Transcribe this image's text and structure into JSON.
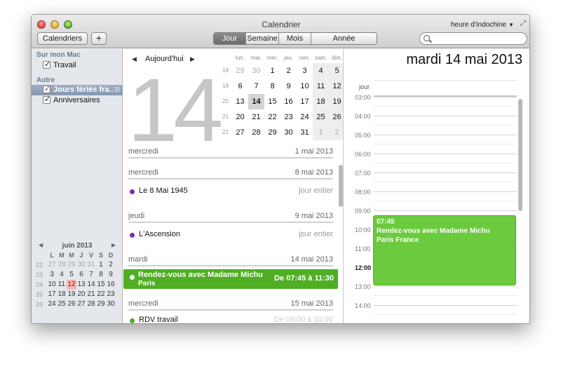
{
  "window": {
    "title": "Calendrier",
    "timezone": "heure d'Indochine"
  },
  "toolbar": {
    "calendars_label": "Calendriers",
    "add_label": "+",
    "views": [
      "Jour",
      "Semaine",
      "Mois",
      "Année"
    ],
    "active_view": "Jour",
    "search_placeholder": ""
  },
  "sidebar": {
    "group_mac": "Sur mon Mac",
    "work": "Travail",
    "group_other": "Autre",
    "holidays": "Jours fériés fra...",
    "birthdays": "Anniversaires"
  },
  "mini_calendar": {
    "month": "juin 2013",
    "dow": [
      "L",
      "M",
      "M",
      "J",
      "V",
      "S",
      "D"
    ],
    "weeks": [
      {
        "wk": "22",
        "days": [
          "27",
          "28",
          "29",
          "30",
          "31",
          "1",
          "2"
        ]
      },
      {
        "wk": "23",
        "days": [
          "3",
          "4",
          "5",
          "6",
          "7",
          "8",
          "9"
        ]
      },
      {
        "wk": "24",
        "days": [
          "10",
          "11",
          "12",
          "13",
          "14",
          "15",
          "16"
        ]
      },
      {
        "wk": "25",
        "days": [
          "17",
          "18",
          "19",
          "20",
          "21",
          "22",
          "23"
        ]
      },
      {
        "wk": "26",
        "days": [
          "24",
          "25",
          "26",
          "27",
          "28",
          "29",
          "30"
        ]
      }
    ]
  },
  "middle": {
    "today_label": "Aujourd'hui",
    "big_day": "14",
    "month_cal": {
      "dow": [
        "lun.",
        "mar.",
        "mer.",
        "jeu.",
        "ven.",
        "sam.",
        "dim."
      ],
      "weeks": [
        {
          "wk": "18",
          "days": [
            "29",
            "30",
            "1",
            "2",
            "3",
            "4",
            "5"
          ]
        },
        {
          "wk": "19",
          "days": [
            "6",
            "7",
            "8",
            "9",
            "10",
            "11",
            "12"
          ]
        },
        {
          "wk": "20",
          "days": [
            "13",
            "14",
            "15",
            "16",
            "17",
            "18",
            "19"
          ]
        },
        {
          "wk": "21",
          "days": [
            "20",
            "21",
            "22",
            "23",
            "24",
            "25",
            "26"
          ]
        },
        {
          "wk": "22",
          "days": [
            "27",
            "28",
            "29",
            "30",
            "31",
            "1",
            "2"
          ]
        }
      ]
    },
    "agenda": {
      "d1": {
        "dow": "mercredi",
        "date": "1 mai 2013"
      },
      "d2": {
        "dow": "mercredi",
        "date": "8 mai 2013"
      },
      "e2": {
        "title": "Le 8 Mai 1945",
        "when": "jour entier"
      },
      "d3": {
        "dow": "jeudi",
        "date": "9 mai 2013"
      },
      "e3": {
        "title": "L'Ascension",
        "when": "jour entier"
      },
      "d4": {
        "dow": "mardi",
        "date": "14 mai 2013"
      },
      "e4": {
        "title": "Rendez-vous avec Madame Michu",
        "sub": "Paris",
        "when": "De 07:45 à 11:30"
      },
      "d5": {
        "dow": "mercredi",
        "date": "15 mai 2013"
      },
      "e5": {
        "title": "RDV travail",
        "when": "De 09:00 à 10:00"
      }
    }
  },
  "day_view": {
    "title": "mardi 14 mai 2013",
    "allday_label": "jour",
    "hours": [
      "03:00",
      "04:00",
      "05:00",
      "06:00",
      "07:00",
      "08:00",
      "09:00",
      "10:00",
      "11:00",
      "12:00",
      "13:00",
      "14:00"
    ],
    "event": {
      "time": "07:45",
      "title": "Rendez-vous avec Madame Michu",
      "place": "Paris France"
    }
  },
  "colors": {
    "event_green": "#4fae22",
    "event_block": "#6cca3e",
    "holiday_purple": "#7b2bb0"
  }
}
